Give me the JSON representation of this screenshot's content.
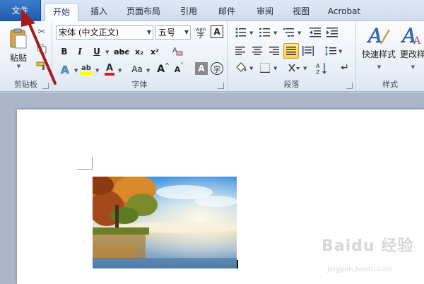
{
  "tabs": {
    "file": "文件",
    "home": "开始",
    "insert": "插入",
    "page_layout": "页面布局",
    "references": "引用",
    "mailings": "邮件",
    "review": "审阅",
    "view": "视图",
    "acrobat": "Acrobat"
  },
  "clipboard": {
    "paste_label": "粘贴",
    "group_label": "剪贴板"
  },
  "font": {
    "font_name": "宋体 (中文正文)",
    "font_size": "五号",
    "wen_icon_char": "wén",
    "group_label": "字体",
    "bold": "B",
    "italic": "I",
    "underline": "U",
    "strike": "abc",
    "subscript": "x₂",
    "superscript": "x²",
    "grow": "A",
    "shrink": "A",
    "change_case": "Aa",
    "clear": "A",
    "char_border": "A",
    "enclose": "字"
  },
  "paragraph": {
    "group_label": "段落"
  },
  "styles": {
    "quick_styles_label": "快速样式",
    "change_styles_label": "更改样",
    "group_label": "样式"
  },
  "watermark": {
    "brand": "Baidu 经验",
    "url": "jingyan.baidu.com"
  },
  "colors": {
    "file_tab": "#2a66b8",
    "arrow": "#a31b1b",
    "font_color": "#d02020",
    "highlight": "#ffff00"
  }
}
